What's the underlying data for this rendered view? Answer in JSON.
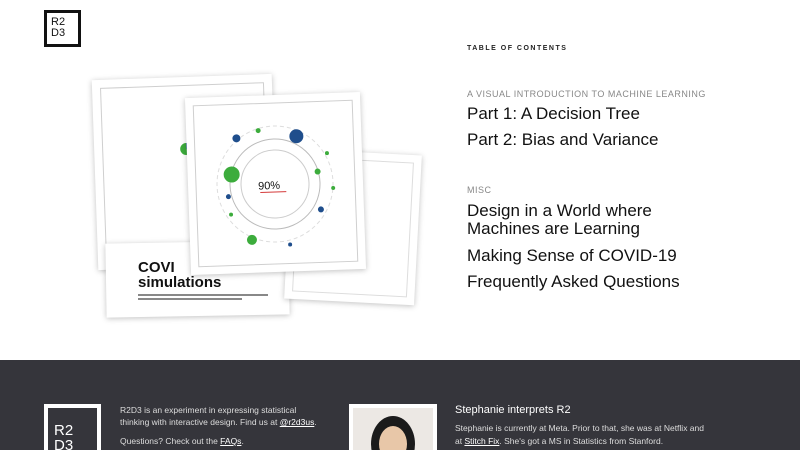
{
  "logo": {
    "line1": "R2",
    "line2": "D3"
  },
  "hero": {
    "percent_label": "90%",
    "covid_title_line1": "COVI",
    "covid_title_line2": "simulations"
  },
  "toc": {
    "heading": "TABLE OF CONTENTS",
    "sections": [
      {
        "label": "A VISUAL INTRODUCTION TO MACHINE LEARNING",
        "links": [
          "Part 1: A Decision Tree",
          "Part 2: Bias and Variance"
        ]
      },
      {
        "label": "MISC",
        "links": [
          "Design in a World where",
          "Machines are Learning",
          "Making Sense of COVID-19",
          "Frequently Asked Questions"
        ]
      }
    ]
  },
  "footer": {
    "logo": {
      "line1": "R2",
      "line2": "D3"
    },
    "about_prefix": "R2D3 is an experiment in expressing statistical",
    "about_line2_prefix": "thinking with interactive design. Find us at ",
    "about_handle": "@r2d3us",
    "about_suffix": ".",
    "questions_prefix": "Questions? Check out the ",
    "questions_link": "FAQs",
    "questions_suffix": ".",
    "person_title": "Stephanie interprets R2",
    "person_line1": "Stephanie is currently at Meta. Prior to that, she was at Netflix and",
    "person_line2_prefix": "at ",
    "person_link": "Stitch Fix",
    "person_line2_suffix": ". She's got a MS in Statistics from Stanford."
  },
  "colors": {
    "footer_bg": "#35353b",
    "green": "#3cac3c",
    "blue": "#1f4e8c",
    "red": "#d43a3a"
  }
}
